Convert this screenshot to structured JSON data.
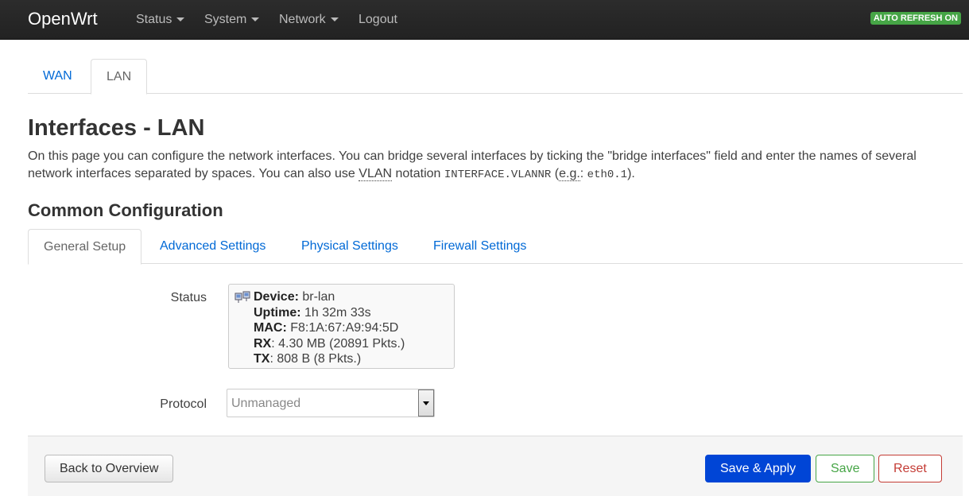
{
  "navbar": {
    "brand": "OpenWrt",
    "menu": [
      {
        "label": "Status",
        "dropdown": true
      },
      {
        "label": "System",
        "dropdown": true
      },
      {
        "label": "Network",
        "dropdown": true
      },
      {
        "label": "Logout",
        "dropdown": false
      }
    ],
    "auto_refresh": "AUTO REFRESH ON"
  },
  "top_tabs": [
    {
      "label": "WAN",
      "active": false
    },
    {
      "label": "LAN",
      "active": true
    }
  ],
  "page": {
    "title": "Interfaces - LAN",
    "desc_part1": "On this page you can configure the network interfaces. You can bridge several interfaces by ticking the \"bridge interfaces\" field and enter the names of several network interfaces separated by spaces. You can also use ",
    "desc_vlan": "VLAN",
    "desc_part2": " notation ",
    "desc_code1": "INTERFACE.VLANNR",
    "desc_part3": " (",
    "desc_eg": "e.g.",
    "desc_part4": ": ",
    "desc_code2": "eth0.1",
    "desc_part5": ").",
    "section_title": "Common Configuration"
  },
  "sub_tabs": [
    {
      "label": "General Setup",
      "active": true
    },
    {
      "label": "Advanced Settings",
      "active": false
    },
    {
      "label": "Physical Settings",
      "active": false
    },
    {
      "label": "Firewall Settings",
      "active": false
    }
  ],
  "status": {
    "label": "Status",
    "device_label": "Device:",
    "device_value": " br-lan",
    "uptime_label": "Uptime:",
    "uptime_value": " 1h 32m 33s",
    "mac_label": "MAC:",
    "mac_value": " F8:1A:67:A9:94:5D",
    "rx_label": "RX",
    "rx_value": ": 4.30 MB (20891 Pkts.)",
    "tx_label": "TX",
    "tx_value": ": 808 B (8 Pkts.)",
    "icon": "network-interface-icon"
  },
  "protocol": {
    "label": "Protocol",
    "selected": "Unmanaged"
  },
  "footer": {
    "back": "Back to Overview",
    "save_apply": "Save & Apply",
    "save": "Save",
    "reset": "Reset"
  },
  "colors": {
    "link": "#0069d6",
    "primary": "#0045d6",
    "success": "#46a546",
    "danger": "#c43c35"
  }
}
